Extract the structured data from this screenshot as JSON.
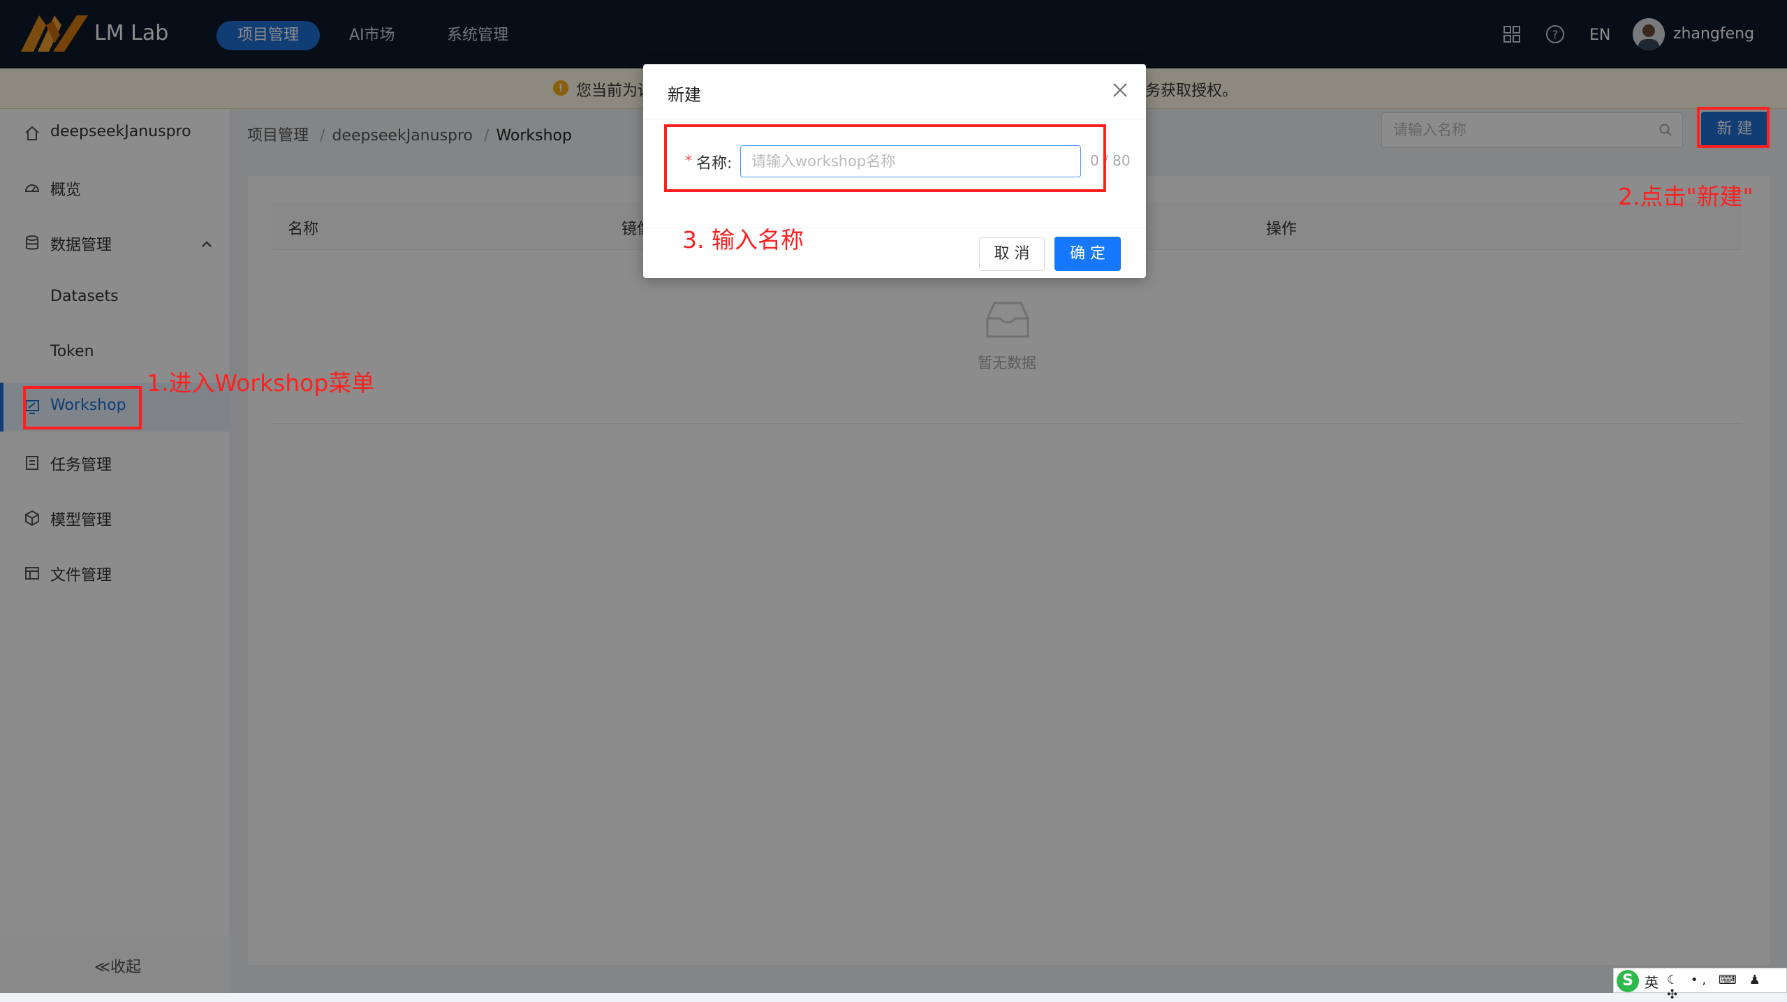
{
  "app": {
    "title": "LM Lab"
  },
  "topnav": {
    "items": [
      {
        "label": "项目管理",
        "active": true
      },
      {
        "label": "AI市场",
        "active": false
      },
      {
        "label": "系统管理",
        "active": false
      }
    ],
    "lang": "EN",
    "username": "zhangfeng"
  },
  "notice": {
    "text_left": "您当前为读",
    "text_right": "务获取授权。"
  },
  "sidebar": {
    "project": "deepseekJanuspro",
    "items": [
      {
        "label": "概览",
        "icon": "dashboard-icon"
      },
      {
        "label": "数据管理",
        "icon": "database-icon",
        "expanded": true
      },
      {
        "label": "Datasets",
        "sub": true
      },
      {
        "label": "Token",
        "sub": true
      },
      {
        "label": "Workshop",
        "icon": "workshop-icon",
        "active": true
      },
      {
        "label": "任务管理",
        "icon": "task-icon"
      },
      {
        "label": "模型管理",
        "icon": "model-icon"
      },
      {
        "label": "文件管理",
        "icon": "file-icon"
      }
    ],
    "collapse_label": "≪收起"
  },
  "breadcrumb": {
    "items": [
      "项目管理",
      "deepseekJanuspro",
      "Workshop"
    ],
    "separator": "/"
  },
  "toolbar": {
    "search_placeholder": "请输入名称",
    "new_label": "新 建"
  },
  "table": {
    "columns": [
      "名称",
      "镜像",
      "操作"
    ],
    "empty_text": "暂无数据"
  },
  "modal": {
    "title": "新建",
    "field_label": "名称:",
    "required_mark": "*",
    "input_placeholder": "请输入workshop名称",
    "counter": "0 / 80",
    "cancel_label": "取 消",
    "ok_label": "确 定"
  },
  "annotations": {
    "step1": "1.进入Workshop菜单",
    "step2": "2.点击\"新建\"",
    "step3": "3. 输入名称",
    "color": "#ff1f1f"
  },
  "ime": {
    "lang": "英"
  },
  "colors": {
    "topbar": "#0e1a2b",
    "accent": "#1f6fd6",
    "primary": "#1677ff"
  }
}
